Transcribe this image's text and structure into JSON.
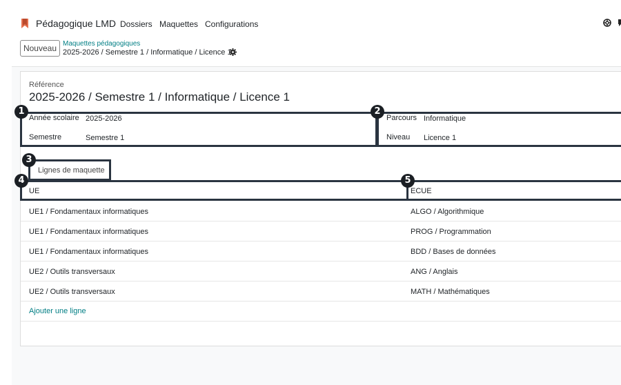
{
  "navbar": {
    "app_title": "Pédagogique LMD",
    "menu": [
      "Dossiers",
      "Maquettes",
      "Configurations"
    ],
    "right_icons": [
      "support-icon",
      "chat-icon"
    ]
  },
  "control_panel": {
    "new_button": "Nouveau",
    "breadcrumb_parent": "Maquettes pédagogiques",
    "breadcrumb_current": "2025-2026 / Semestre 1 / Informatique / Licence 1",
    "action_icon": "gear-icon"
  },
  "form": {
    "reference_label": "Référence",
    "reference_value": "2025-2026 / Semestre 1 / Informatique / Licence 1",
    "left_group": {
      "year_label": "Année scolaire",
      "year_value": "2025-2026",
      "semester_label": "Semestre",
      "semester_value": "Semestre 1"
    },
    "right_group": {
      "parcours_label": "Parcours",
      "parcours_value": "Informatique",
      "niveau_label": "Niveau",
      "niveau_value": "Licence 1"
    }
  },
  "annotations": [
    "1",
    "2",
    "3",
    "4",
    "5"
  ],
  "tab": {
    "label": "Lignes de maquette"
  },
  "table": {
    "columns": [
      "UE",
      "ECUE"
    ],
    "rows": [
      [
        "UE1 / Fondamentaux informatiques",
        "ALGO / Algorithmique"
      ],
      [
        "UE1 / Fondamentaux informatiques",
        "PROG / Programmation"
      ],
      [
        "UE1 / Fondamentaux informatiques",
        "BDD / Bases de données"
      ],
      [
        "UE2 / Outils transversaux",
        "ANG / Anglais"
      ],
      [
        "UE2 / Outils transversaux",
        "MATH / Mathématiques"
      ]
    ],
    "add_line": "Ajouter une ligne"
  },
  "colors": {
    "accent": "#017e84",
    "brand": "#e46f4e",
    "annotation": "#1b1f24"
  }
}
